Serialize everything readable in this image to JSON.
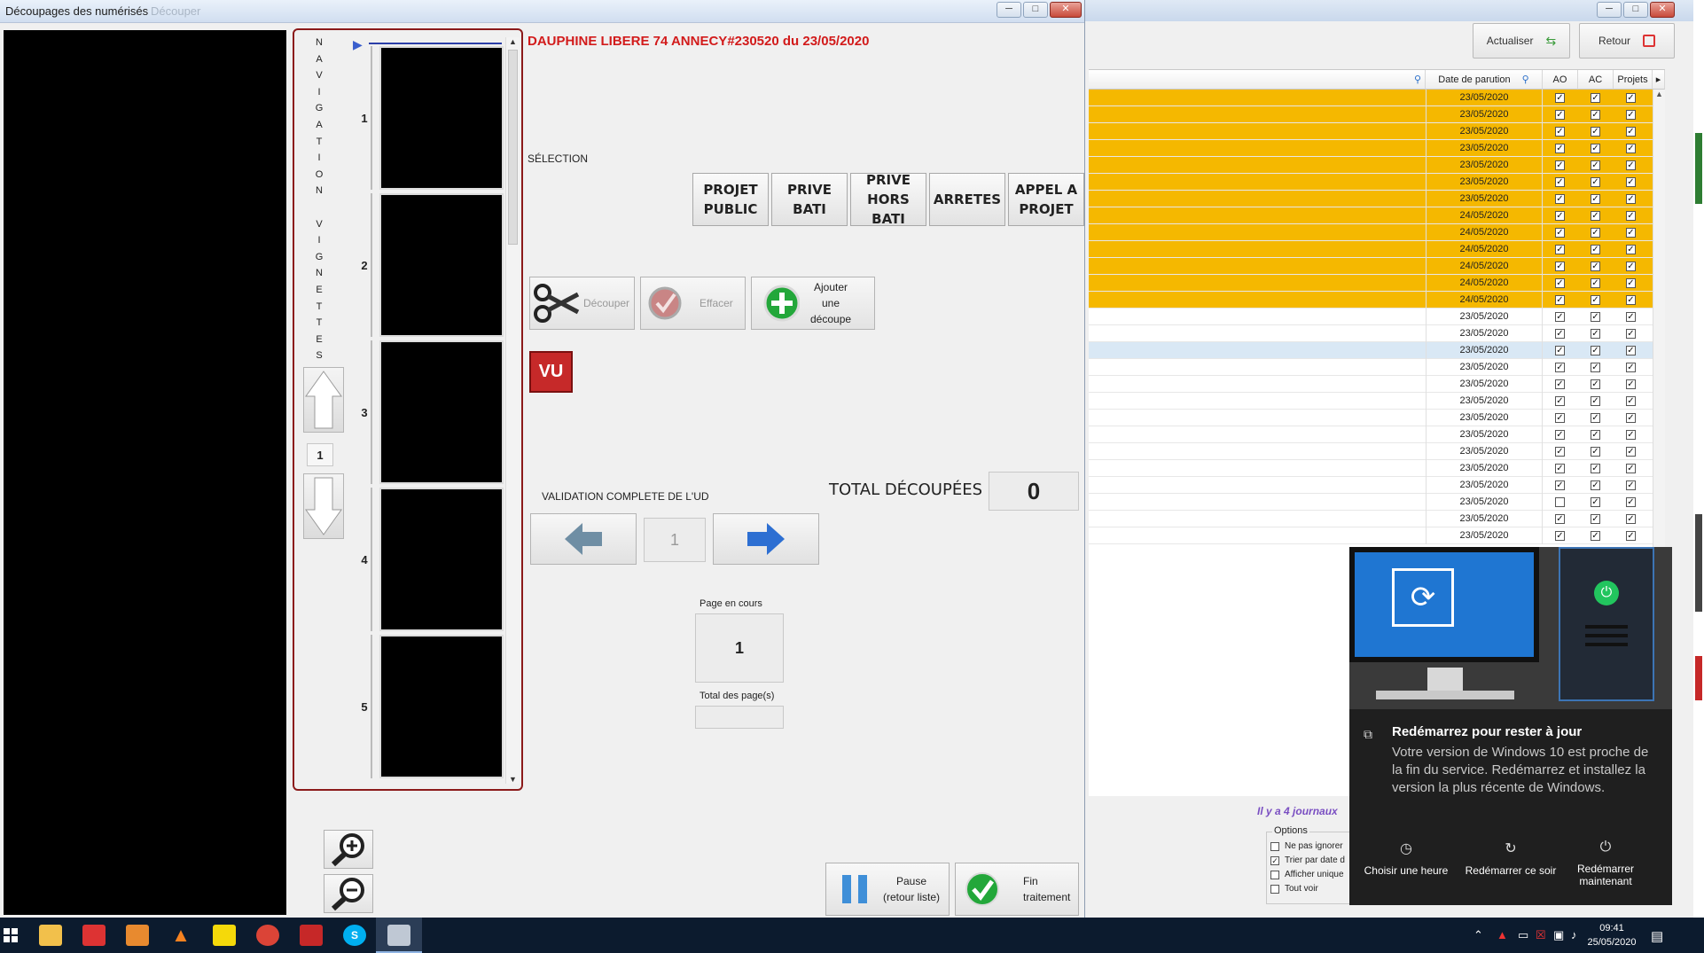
{
  "main_window": {
    "title": "Découpages des  numérisés",
    "title_faded": "Découper",
    "newspaper_title": "DAUPHINE LIBERE 74 ANNECY#230520 du 23/05/2020",
    "navigation_label": "NAVIGATION VIGNETTES",
    "navigation_letters": [
      "N",
      "A",
      "V",
      "I",
      "G",
      "A",
      "T",
      "I",
      "O",
      "N",
      "",
      "V",
      "I",
      "G",
      "N",
      "E",
      "T",
      "T",
      "E",
      "S"
    ],
    "thumbnails": [
      "1",
      "2",
      "3",
      "4",
      "5"
    ],
    "nav_page_value": "1",
    "selection_label": "SÉLECTION",
    "categories": [
      {
        "line1": "PROJET",
        "line2": "PUBLIC"
      },
      {
        "line1": "PRIVE BATI",
        "line2": ""
      },
      {
        "line1": "PRIVE",
        "line2": "HORS BATI"
      },
      {
        "line1": "ARRETES",
        "line2": ""
      },
      {
        "line1": "APPEL A",
        "line2": "PROJET"
      }
    ],
    "tools": {
      "cut": "Découper",
      "erase": "Effacer",
      "add_line1": "Ajouter",
      "add_line2": "une",
      "add_line3": "découpe",
      "vu": "VU"
    },
    "validation_label": "VALIDATION COMPLETE DE L'UD",
    "validation_value": "1",
    "total_label": "TOTAL DÉCOUPÉES",
    "total_value": "0",
    "current_page_label": "Page en cours",
    "current_page_value": "1",
    "total_pages_label": "Total des page(s)",
    "total_pages_value": "",
    "pause_line1": "Pause",
    "pause_line2": "(retour liste)",
    "end_line1": "Fin",
    "end_line2": "traitement",
    "window_controls": [
      "─",
      "□",
      "✕"
    ]
  },
  "back_window": {
    "refresh_label": "Actualiser",
    "back_label": "Retour",
    "columns": [
      "Date de parution",
      "AO",
      "AC",
      "Projets"
    ],
    "rows": [
      {
        "date": "23/05/2020",
        "ao": true,
        "ac": true,
        "proj": true,
        "hl": true
      },
      {
        "date": "23/05/2020",
        "ao": true,
        "ac": true,
        "proj": true,
        "hl": true
      },
      {
        "date": "23/05/2020",
        "ao": true,
        "ac": true,
        "proj": true,
        "hl": true
      },
      {
        "date": "23/05/2020",
        "ao": true,
        "ac": true,
        "proj": true,
        "hl": true
      },
      {
        "date": "23/05/2020",
        "ao": true,
        "ac": true,
        "proj": true,
        "hl": true
      },
      {
        "date": "23/05/2020",
        "ao": true,
        "ac": true,
        "proj": true,
        "hl": true
      },
      {
        "date": "23/05/2020",
        "ao": true,
        "ac": true,
        "proj": true,
        "hl": true
      },
      {
        "date": "24/05/2020",
        "ao": true,
        "ac": true,
        "proj": true,
        "hl": true
      },
      {
        "date": "24/05/2020",
        "ao": true,
        "ac": true,
        "proj": true,
        "hl": true
      },
      {
        "date": "24/05/2020",
        "ao": true,
        "ac": true,
        "proj": true,
        "hl": true
      },
      {
        "date": "24/05/2020",
        "ao": true,
        "ac": true,
        "proj": true,
        "hl": true
      },
      {
        "date": "24/05/2020",
        "ao": true,
        "ac": true,
        "proj": true,
        "hl": true
      },
      {
        "date": "24/05/2020",
        "ao": true,
        "ac": true,
        "proj": true,
        "hl": true
      },
      {
        "date": "23/05/2020",
        "ao": true,
        "ac": true,
        "proj": true,
        "hl": false
      },
      {
        "date": "23/05/2020",
        "ao": true,
        "ac": true,
        "proj": true,
        "hl": false
      },
      {
        "date": "23/05/2020",
        "ao": true,
        "ac": true,
        "proj": true,
        "hl": false,
        "sel": true
      },
      {
        "date": "23/05/2020",
        "ao": true,
        "ac": true,
        "proj": true,
        "hl": false
      },
      {
        "date": "23/05/2020",
        "ao": true,
        "ac": true,
        "proj": true,
        "hl": false
      },
      {
        "date": "23/05/2020",
        "ao": true,
        "ac": true,
        "proj": true,
        "hl": false
      },
      {
        "date": "23/05/2020",
        "ao": true,
        "ac": true,
        "proj": true,
        "hl": false
      },
      {
        "date": "23/05/2020",
        "ao": true,
        "ac": true,
        "proj": true,
        "hl": false
      },
      {
        "date": "23/05/2020",
        "ao": true,
        "ac": true,
        "proj": true,
        "hl": false
      },
      {
        "date": "23/05/2020",
        "ao": true,
        "ac": true,
        "proj": true,
        "hl": false
      },
      {
        "date": "23/05/2020",
        "ao": true,
        "ac": true,
        "proj": true,
        "hl": false
      },
      {
        "date": "23/05/2020",
        "ao": false,
        "ac": true,
        "proj": true,
        "hl": false
      },
      {
        "date": "23/05/2020",
        "ao": true,
        "ac": true,
        "proj": true,
        "hl": false
      },
      {
        "date": "23/05/2020",
        "ao": true,
        "ac": true,
        "proj": true,
        "hl": false
      }
    ],
    "journals_note": "Il y a 4 journaux",
    "options_title": "Options",
    "options": [
      {
        "label": "Ne pas ignorer",
        "checked": false
      },
      {
        "label": "Trier par date d",
        "checked": true
      },
      {
        "label": "Afficher unique",
        "checked": false
      },
      {
        "label": "Tout voir",
        "checked": false
      }
    ],
    "highlight_color": "#f5b800",
    "selected_color": "#d9e8f5"
  },
  "notification": {
    "title": "Redémarrez pour rester à jour",
    "body": "Votre version de Windows 10 est proche de la fin du service. Redémarrez et installez la version la plus récente de Windows.",
    "actions": [
      {
        "label": "Choisir une heure",
        "icon": "clock-icon"
      },
      {
        "label": "Redémarrer ce soir",
        "icon": "restart-icon"
      },
      {
        "label": "Redémarrer maintenant",
        "icon": "power-icon"
      }
    ]
  },
  "taskbar": {
    "time": "09:41",
    "date": "25/05/2020"
  }
}
